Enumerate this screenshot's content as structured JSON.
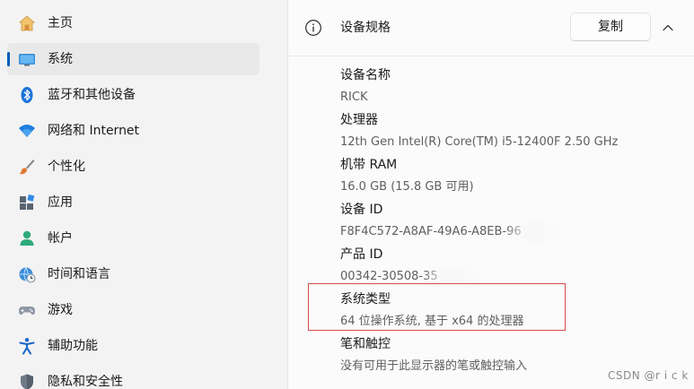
{
  "sidebar": {
    "items": [
      {
        "label": "主页",
        "icon": "home-icon"
      },
      {
        "label": "系统",
        "icon": "system-display-icon",
        "active": true
      },
      {
        "label": "蓝牙和其他设备",
        "icon": "bluetooth-icon"
      },
      {
        "label": "网络和 Internet",
        "icon": "wifi-icon"
      },
      {
        "label": "个性化",
        "icon": "paintbrush-icon"
      },
      {
        "label": "应用",
        "icon": "apps-icon"
      },
      {
        "label": "帐户",
        "icon": "account-icon"
      },
      {
        "label": "时间和语言",
        "icon": "globe-clock-icon"
      },
      {
        "label": "游戏",
        "icon": "gamepad-icon"
      },
      {
        "label": "辅助功能",
        "icon": "accessibility-icon"
      },
      {
        "label": "隐私和安全性",
        "icon": "shield-icon"
      }
    ]
  },
  "card": {
    "title": "设备规格",
    "copy_label": "复制",
    "specs": [
      {
        "label": "设备名称",
        "value": "RICK"
      },
      {
        "label": "处理器",
        "value": "12th Gen Intel(R) Core(TM) i5-12400F   2.50 GHz"
      },
      {
        "label": "机带 RAM",
        "value": "16.0 GB (15.8 GB 可用)"
      },
      {
        "label": "设备 ID",
        "value": "F8F4C572-A8AF-49A6-A8EB-96"
      },
      {
        "label": "产品 ID",
        "value": "00342-30508-35"
      },
      {
        "label": "系统类型",
        "value": "64 位操作系统, 基于 x64 的处理器"
      },
      {
        "label": "笔和触控",
        "value": "没有可用于此显示器的笔或触控输入"
      }
    ]
  },
  "watermark": "CSDN @r i c k",
  "colors": {
    "accent": "#005fb8",
    "highlight": "#d94a4a",
    "background": "#f3f3f3",
    "card": "#fbfbfb"
  }
}
